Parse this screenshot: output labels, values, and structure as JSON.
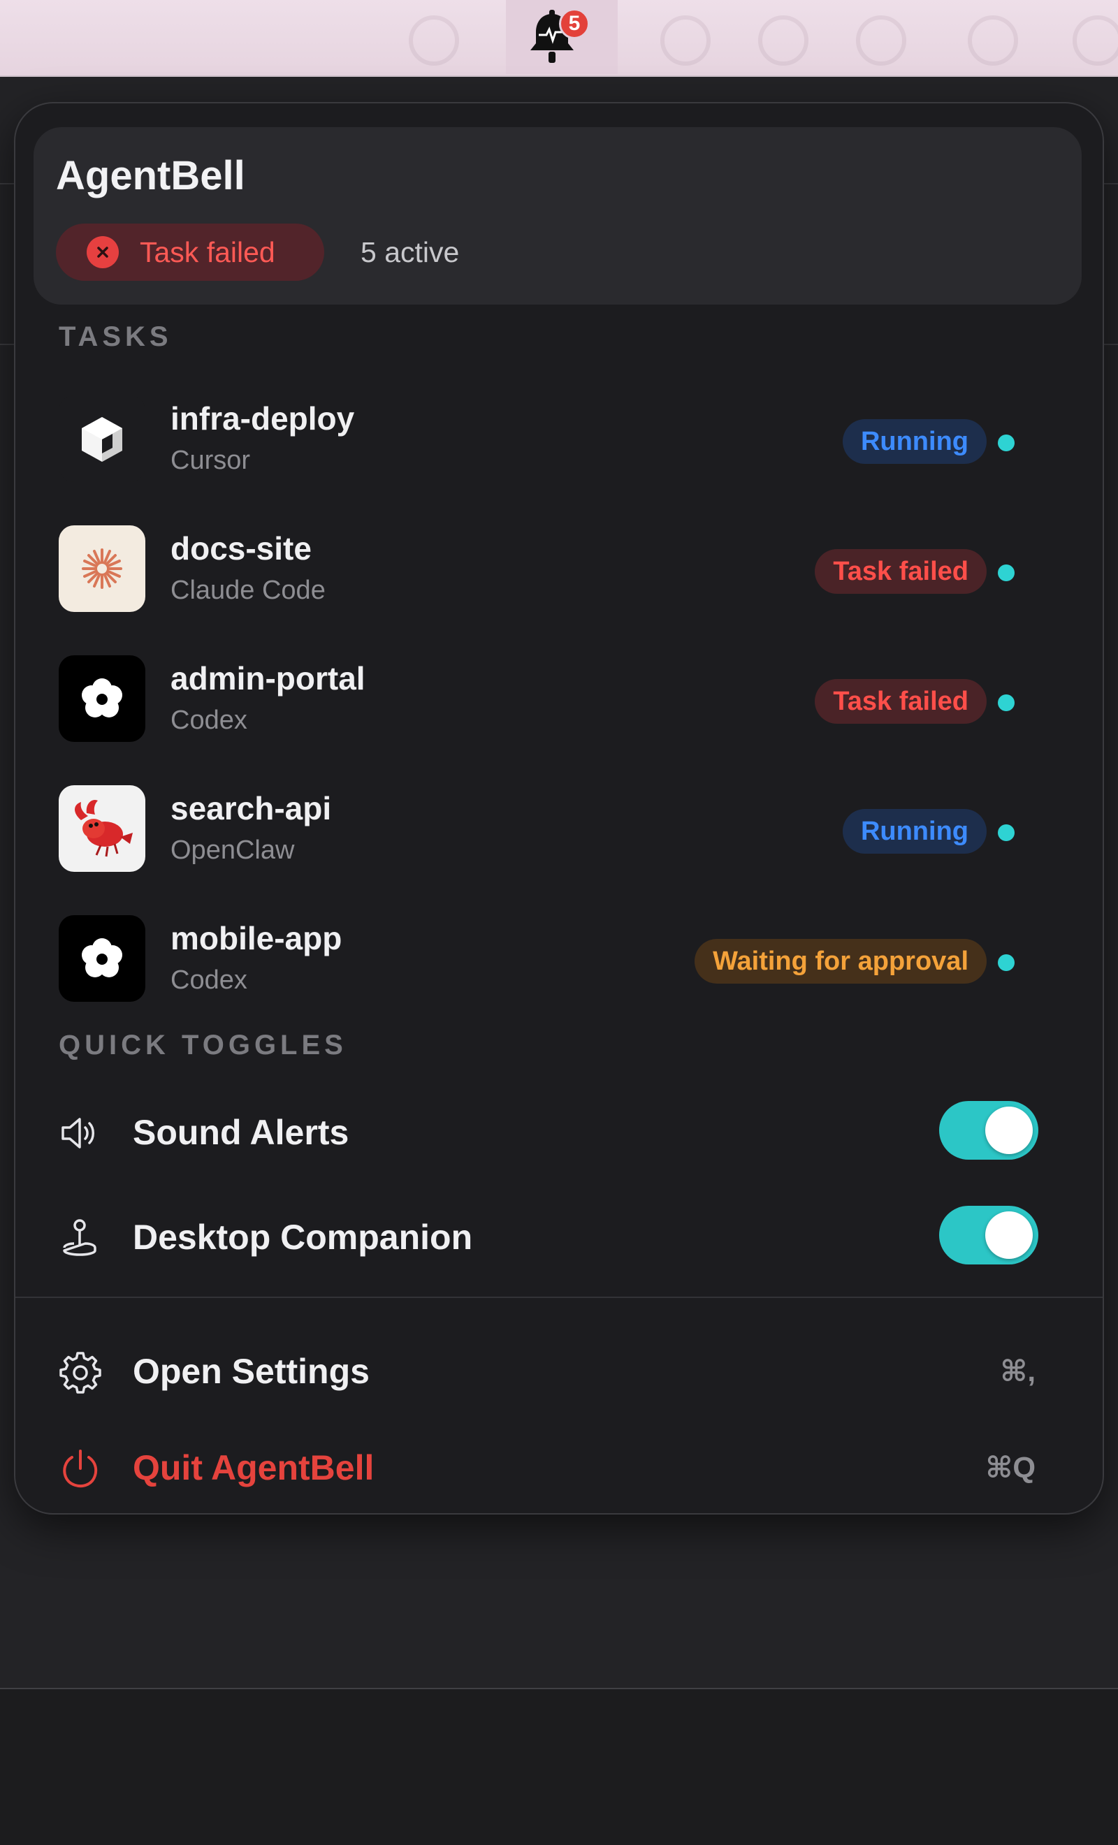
{
  "menubar": {
    "notification_count": "5"
  },
  "header": {
    "title": "AgentBell",
    "status_label": "Task failed",
    "active_count": "5 active"
  },
  "tasks": {
    "section_label": "TASKS",
    "items": [
      {
        "name": "infra-deploy",
        "agent": "Cursor",
        "status": "Running",
        "status_kind": "running",
        "icon": "cursor-cube-icon"
      },
      {
        "name": "docs-site",
        "agent": "Claude Code",
        "status": "Task failed",
        "status_kind": "failed",
        "icon": "claude-starburst-icon"
      },
      {
        "name": "admin-portal",
        "agent": "Codex",
        "status": "Task failed",
        "status_kind": "failed",
        "icon": "codex-flower-icon"
      },
      {
        "name": "search-api",
        "agent": "OpenClaw",
        "status": "Running",
        "status_kind": "running",
        "icon": "openclaw-lobster-icon"
      },
      {
        "name": "mobile-app",
        "agent": "Codex",
        "status": "Waiting for approval",
        "status_kind": "waiting",
        "icon": "codex-flower-icon"
      }
    ]
  },
  "toggles": {
    "section_label": "QUICK TOGGLES",
    "items": [
      {
        "label": "Sound Alerts",
        "on": true,
        "icon": "speaker-icon"
      },
      {
        "label": "Desktop Companion",
        "on": true,
        "icon": "joystick-icon"
      }
    ]
  },
  "menu": {
    "settings_label": "Open Settings",
    "settings_shortcut": "⌘,",
    "quit_label": "Quit AgentBell",
    "quit_shortcut": "⌘Q"
  },
  "colors": {
    "accent_teal": "#2cc6c6",
    "running": "#3d8bfd",
    "failed": "#ff4f4a",
    "waiting": "#f4a23a",
    "quit": "#e5433d"
  }
}
